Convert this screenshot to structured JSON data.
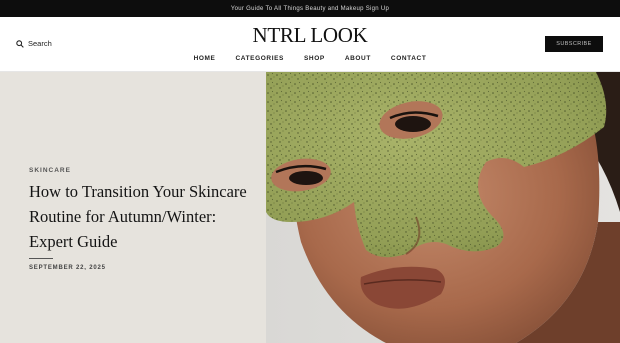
{
  "announcement": "Your Guide To All Things Beauty and Makeup Sign Up",
  "header": {
    "search_label": "Search",
    "logo": "NTRL LOOK",
    "subscribe_label": "SUBSCRIBE"
  },
  "nav": [
    "HOME",
    "CATEGORIES",
    "SHOP",
    "ABOUT",
    "CONTACT"
  ],
  "hero": {
    "category": "SKINCARE",
    "title": "How to Transition Your Skincare Routine for Autumn/Winter: Expert Guide",
    "date": "SEPTEMBER 22, 2025",
    "image_alt": "face-with-green-sheet-mask"
  },
  "colors": {
    "topbar_bg": "#0d0d0d",
    "hero_left_bg": "#e6e3dd",
    "mask_green": "#97a358"
  }
}
